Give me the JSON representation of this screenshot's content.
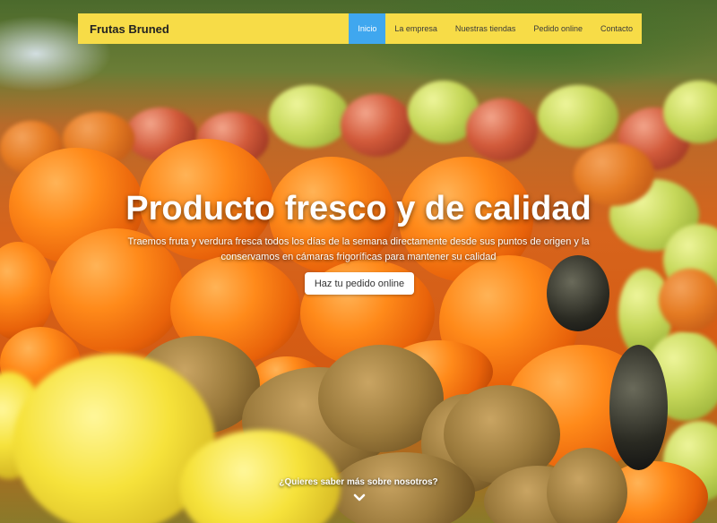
{
  "navbar": {
    "brand": "Frutas Bruned",
    "items": [
      {
        "label": "Inicio",
        "active": true
      },
      {
        "label": "La empresa",
        "active": false
      },
      {
        "label": "Nuestras tiendas",
        "active": false
      },
      {
        "label": "Pedido online",
        "active": false
      },
      {
        "label": "Contacto",
        "active": false
      }
    ]
  },
  "hero": {
    "headline": "Producto fresco y de calidad",
    "lead": "Traemos fruta y verdura fresca todos los días de la semana directamente desde sus puntos de origen y la conservamos en cámaras frigoríficas para mantener su calidad",
    "cta_label": "Haz tu pedido online",
    "more_label": "¿Quieres saber más sobre nosotros?",
    "more_icon": "chevron-down-icon"
  },
  "colors": {
    "navbar_bg": "#f7dc47",
    "active_nav_bg": "#3fa7ef"
  }
}
